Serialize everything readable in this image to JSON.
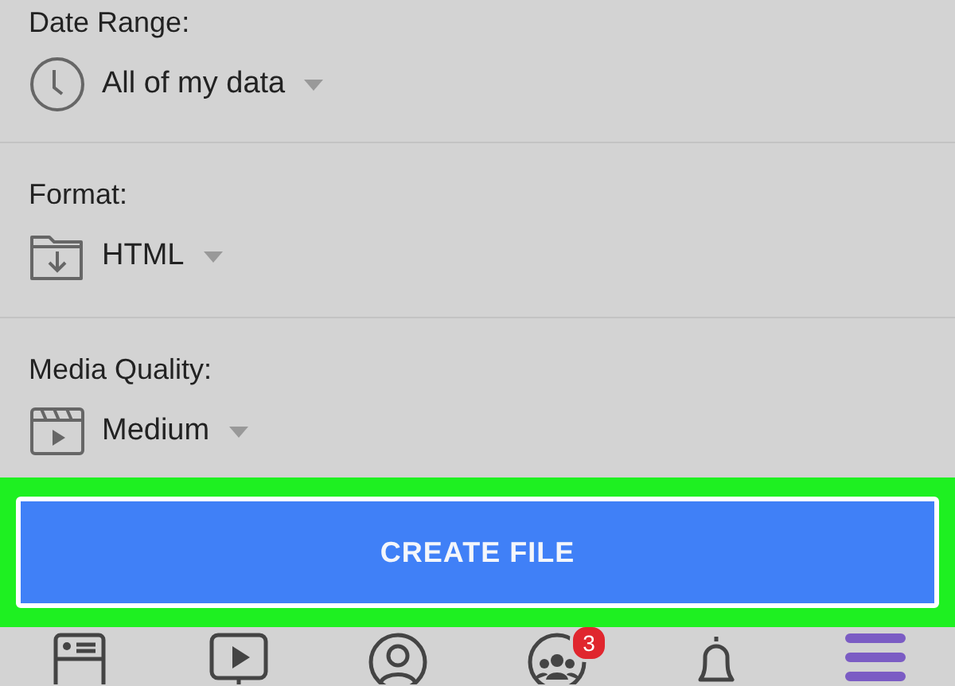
{
  "settings": [
    {
      "kind": "clock",
      "label": "Date Range:",
      "value": "All of my data"
    },
    {
      "kind": "folder",
      "label": "Format:",
      "value": "HTML"
    },
    {
      "kind": "video",
      "label": "Media Quality:",
      "value": "Medium"
    }
  ],
  "highlight": true,
  "button": "CREATE FILE",
  "tabs": [
    {
      "kind": "feed",
      "selected": false
    },
    {
      "kind": "watch",
      "selected": false
    },
    {
      "kind": "profile",
      "selected": false
    },
    {
      "kind": "groups",
      "selected": false,
      "badge": "3"
    },
    {
      "kind": "bell",
      "selected": false
    },
    {
      "kind": "menu",
      "selected": true
    }
  ]
}
